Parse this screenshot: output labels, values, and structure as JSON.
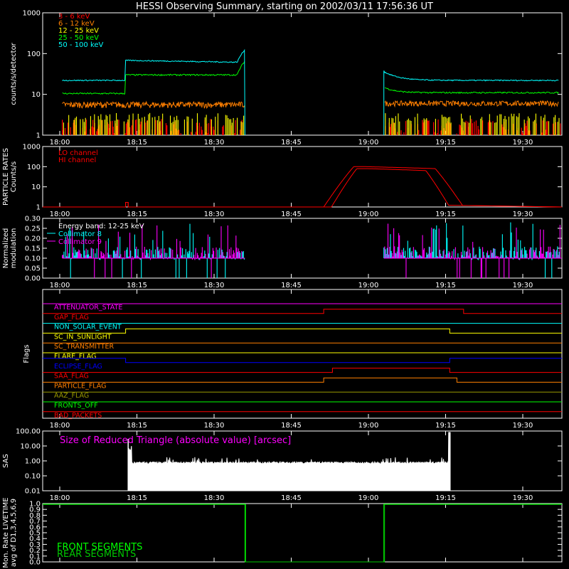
{
  "title": "HESSI Observing Summary, starting on 2002/03/11 17:56:36 UT",
  "time_ticks": [
    "18:00",
    "18:15",
    "18:30",
    "18:45",
    "19:00",
    "19:15",
    "19:30"
  ],
  "colors": {
    "red": "#ff0000",
    "orange": "#ff7f00",
    "yellow": "#ffff00",
    "green": "#00ff00",
    "cyan": "#00ffff",
    "magenta": "#ff00ff",
    "blue": "#0000ff",
    "white": "#ffffff",
    "olive": "#999900",
    "green2": "#00c800"
  },
  "chart_data": [
    {
      "type": "line",
      "id": "count_rates",
      "ylabel": "counts/s/detector",
      "yscale": "log",
      "ylim": [
        1,
        1000
      ],
      "yticks": [
        "1",
        "10",
        "100",
        "1000"
      ],
      "series": [
        {
          "name": "3 - 6 keV",
          "color": "red",
          "approx_level": "1-3 (pulse train)"
        },
        {
          "name": "6 - 12 keV",
          "color": "orange",
          "approx_level": 5
        },
        {
          "name": "12 - 25 keV",
          "color": "yellow",
          "approx_level": 2
        },
        {
          "name": "25 - 50 keV",
          "color": "green",
          "approx_level": 12
        },
        {
          "name": "50 - 100 keV",
          "color": "cyan",
          "approx_level": 22
        }
      ]
    },
    {
      "type": "line",
      "id": "particle_rates",
      "ylabel": "PARTICLE RATES Counts/s",
      "yscale": "log",
      "ylim": [
        1,
        1000
      ],
      "yticks": [
        "1",
        "10",
        "100",
        "1000"
      ],
      "series": [
        {
          "name": "LO channel",
          "color": "red"
        },
        {
          "name": "HI channel",
          "color": "red"
        }
      ]
    },
    {
      "type": "line",
      "id": "modulation",
      "ylabel": "Normalized modulation",
      "ylim": [
        0.0,
        0.3
      ],
      "yticks": [
        "0.00",
        "0.05",
        "0.10",
        "0.15",
        "0.20",
        "0.25",
        "0.30"
      ],
      "annotation": "Energy band: 12-25 keV",
      "series": [
        {
          "name": "Collimator 8",
          "color": "cyan"
        },
        {
          "name": "Collimator 9",
          "color": "magenta"
        }
      ]
    },
    {
      "type": "line",
      "id": "flags",
      "ylabel": "Flags",
      "series": [
        {
          "name": "ATTENUATOR_STATE",
          "color": "magenta"
        },
        {
          "name": "GAP_FLAG",
          "color": "red"
        },
        {
          "name": "NON_SOLAR_EVENT",
          "color": "cyan"
        },
        {
          "name": "SC_IN_SUNLIGHT",
          "color": "yellow"
        },
        {
          "name": "SC_TRANSMITTER",
          "color": "orange"
        },
        {
          "name": "FLARE_FLAG",
          "color": "yellow"
        },
        {
          "name": "ECLIPSE_FLAG",
          "color": "blue"
        },
        {
          "name": "SAA_FLAG",
          "color": "red"
        },
        {
          "name": "PARTICLE_FLAG",
          "color": "orange"
        },
        {
          "name": "AAZ_FLAG",
          "color": "olive"
        },
        {
          "name": "FRONTS_OFF",
          "color": "green"
        },
        {
          "name": "BAD_PACKETS",
          "color": "red"
        }
      ]
    },
    {
      "type": "line",
      "id": "sas",
      "ylabel": "SAS",
      "yscale": "log",
      "ylim": [
        0.01,
        100.0
      ],
      "yticks": [
        "0.01",
        "0.10",
        "1.00",
        "10.00",
        "100.00"
      ],
      "annotation": "Size of Reduced Triangle (absolute value) [arcsec]",
      "series": [
        {
          "name": "Size of Reduced Triangle",
          "color": "white"
        }
      ]
    },
    {
      "type": "line",
      "id": "livetime",
      "ylabel": "Mon. Rate LIVETIME avg of D1,3,4,5,6,9",
      "ylim": [
        0.0,
        1.0
      ],
      "yticks": [
        "0.0",
        "0.1",
        "0.2",
        "0.3",
        "0.4",
        "0.5",
        "0.6",
        "0.7",
        "0.8",
        "0.9",
        "1.0"
      ],
      "series": [
        {
          "name": "FRONT SEGMENTS",
          "color": "green"
        },
        {
          "name": "REAR SEGMENTS",
          "color": "green2"
        }
      ]
    }
  ]
}
